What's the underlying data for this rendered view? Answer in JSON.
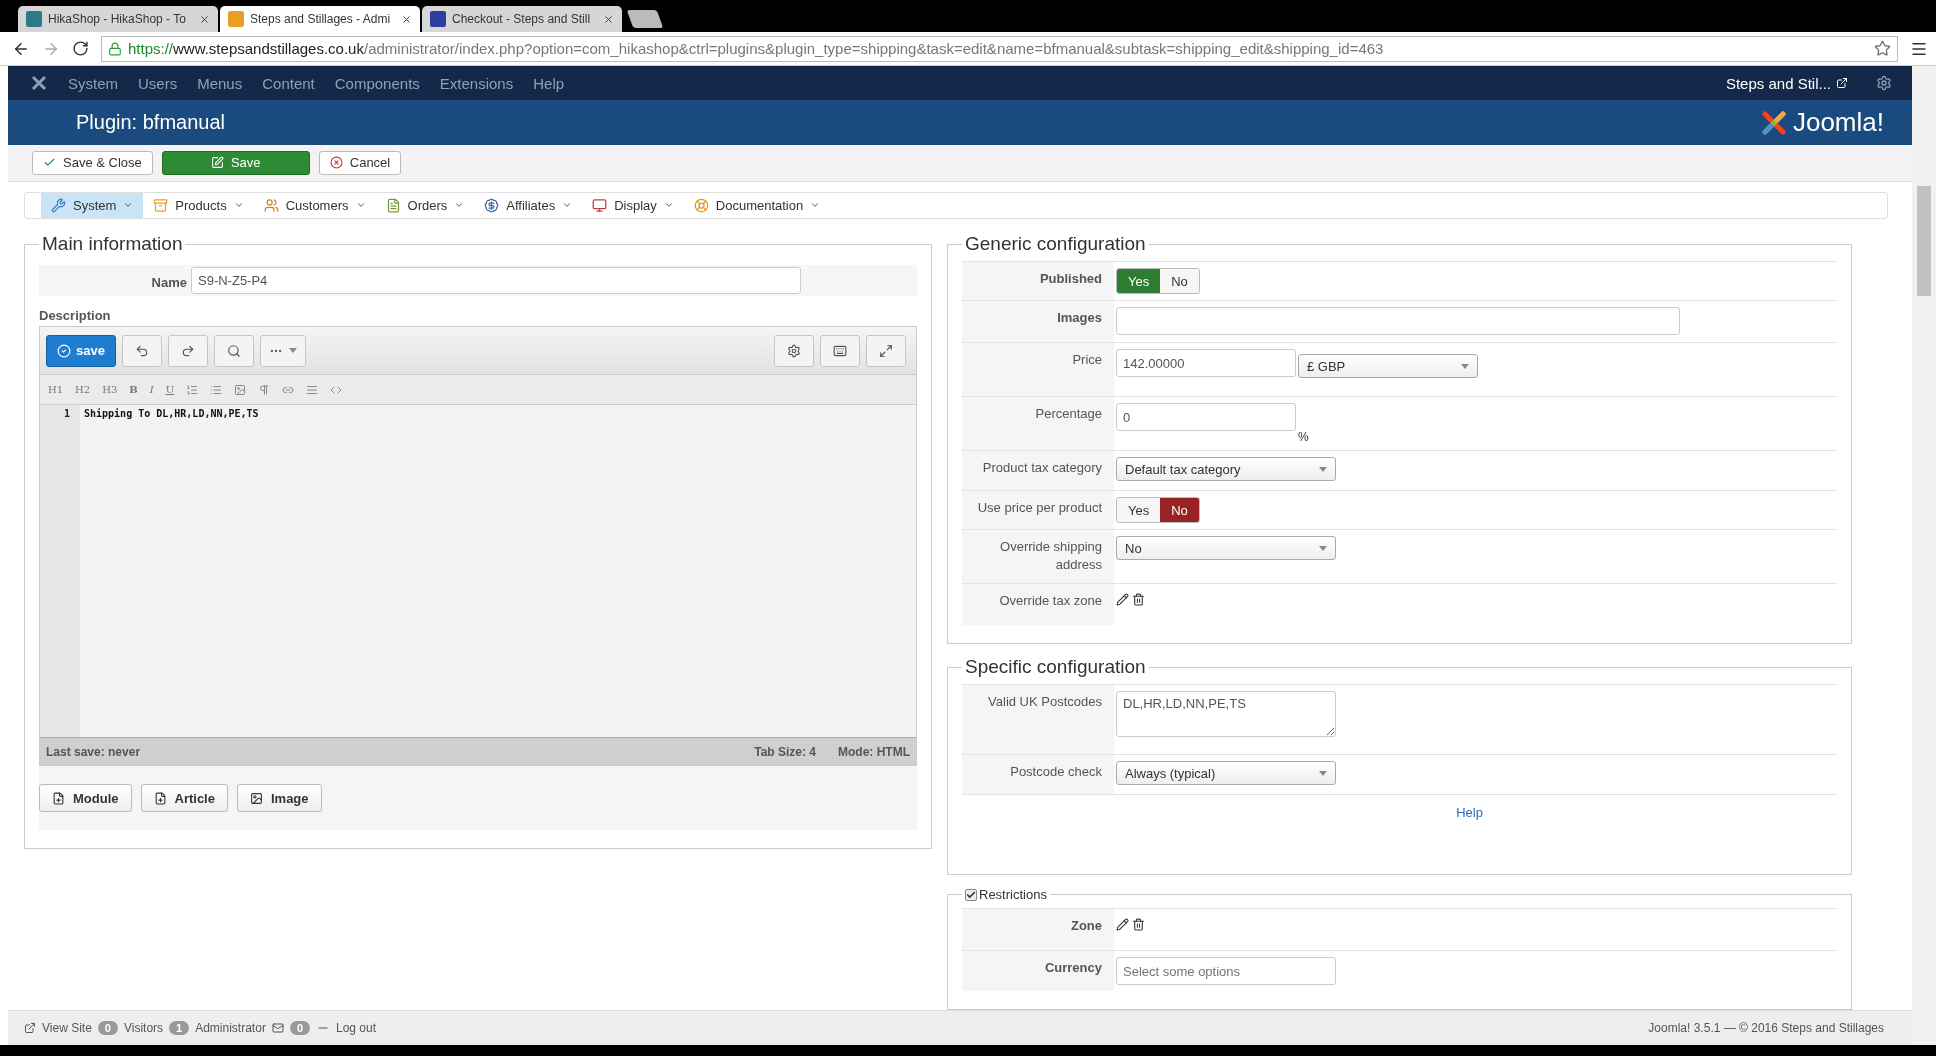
{
  "browser": {
    "tabs": [
      {
        "title": "HikaShop - HikaShop - To",
        "selected": false
      },
      {
        "title": "Steps and Stillages - Admi",
        "selected": true
      },
      {
        "title": "Checkout - Steps and Still",
        "selected": false
      }
    ],
    "url": {
      "scheme": "https://",
      "host": "www.stepsandstillages.co.uk",
      "path": "/administrator/index.php?option=com_hikashop&ctrl=plugins&plugin_type=shipping&task=edit&name=bfmanual&subtask=shipping_edit&shipping_id=463"
    }
  },
  "admin_menu": {
    "items": [
      "System",
      "Users",
      "Menus",
      "Content",
      "Components",
      "Extensions",
      "Help"
    ],
    "site_link": "Steps and Stil..."
  },
  "header": {
    "title": "Plugin: bfmanual",
    "logo": "Joomla!"
  },
  "toolbar": [
    {
      "label": "Save & Close",
      "kind": "close"
    },
    {
      "label": "Save",
      "kind": "save"
    },
    {
      "label": "Cancel",
      "kind": "cancel"
    }
  ],
  "hikashop_menu": [
    {
      "label": "System",
      "selected": true
    },
    {
      "label": "Products",
      "selected": false
    },
    {
      "label": "Customers",
      "selected": false
    },
    {
      "label": "Orders",
      "selected": false
    },
    {
      "label": "Affiliates",
      "selected": false
    },
    {
      "label": "Display",
      "selected": false
    },
    {
      "label": "Documentation",
      "selected": false
    }
  ],
  "main_information": {
    "legend": "Main information",
    "name": {
      "label": "Name",
      "value": "S9-N-Z5-P4"
    },
    "description_label": "Description",
    "editor": {
      "save": "save",
      "format_labels": [
        "H1",
        "H2",
        "H3",
        "B",
        "I",
        "U"
      ],
      "lines": [
        {
          "number": "1",
          "text": "Shipping To DL,HR,LD,NN,PE,TS"
        }
      ],
      "last_save": "Last save: never",
      "tab_size": "Tab Size: 4",
      "mode": "Mode: HTML"
    },
    "insert_buttons": [
      {
        "label": "Module",
        "kind": "document"
      },
      {
        "label": "Article",
        "kind": "document"
      },
      {
        "label": "Image",
        "kind": "image"
      }
    ]
  },
  "generic_configuration": {
    "legend": "Generic configuration",
    "rows": [
      {
        "label": "Published",
        "bold": true,
        "kind": "toggle",
        "options": [
          {
            "label": "Yes",
            "selected": true
          },
          {
            "label": "No",
            "selected": false
          }
        ]
      },
      {
        "label": "Images",
        "bold": true,
        "kind": "input",
        "value": ""
      },
      {
        "label": "Price",
        "bold": false,
        "kind": "price",
        "value": "142.00000",
        "currency": "£ GBP"
      },
      {
        "label": "Percentage",
        "bold": false,
        "kind": "percent",
        "value": "0",
        "unit": "%"
      },
      {
        "label": "Product tax category",
        "bold": false,
        "kind": "select",
        "value": "Default tax category"
      },
      {
        "label": "Use price per product",
        "bold": false,
        "kind": "toggle",
        "options": [
          {
            "label": "Yes",
            "selected": false
          },
          {
            "label": "No",
            "selected": true
          }
        ]
      },
      {
        "label": "Override shipping address",
        "bold": false,
        "kind": "select",
        "value": "No"
      },
      {
        "label": "Override tax zone",
        "bold": false,
        "kind": "icons"
      }
    ]
  },
  "specific_configuration": {
    "legend": "Specific configuration",
    "rows": [
      {
        "label": "Valid UK Postcodes",
        "bold": false,
        "kind": "textarea",
        "value": "DL,HR,LD,NN,PE,TS"
      },
      {
        "label": "Postcode check",
        "bold": false,
        "kind": "select",
        "value": "Always (typical)"
      }
    ],
    "help": "Help"
  },
  "restrictions": {
    "legend": "Restrictions",
    "checked": true,
    "rows": [
      {
        "label": "Zone",
        "bold": true,
        "kind": "icons"
      },
      {
        "label": "Currency",
        "bold": true,
        "kind": "multiselect",
        "placeholder": "Select some options"
      }
    ]
  },
  "status_bar": {
    "view_site": "View Site",
    "visitors_count": "0",
    "visitors": "Visitors",
    "admins_count": "1",
    "admins": "Administrator",
    "messages_count": "0",
    "logout": "Log out",
    "footer": "Joomla! 3.5.1  —  © 2016 Steps and Stillages"
  }
}
